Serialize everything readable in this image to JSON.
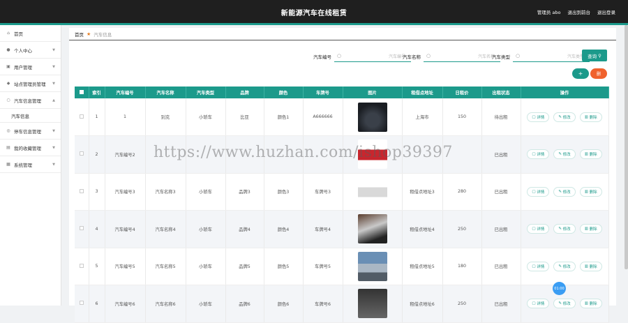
{
  "header": {
    "title": "新能源汽车在线租赁",
    "admin_label": "管理员 abo",
    "back_label": "退出到前台",
    "logout_label": "退出登录"
  },
  "sidebar": {
    "items": [
      {
        "label": "首页",
        "icon": "home-icon"
      },
      {
        "label": "个人中心",
        "icon": "user-icon"
      },
      {
        "label": "用户管理",
        "icon": "users-icon"
      },
      {
        "label": "站点管理员管理",
        "icon": "pin-icon"
      },
      {
        "label": "汽车信息管理",
        "icon": "car-icon"
      },
      {
        "label": "汽车信息",
        "sub": true
      },
      {
        "label": "停车信息管理",
        "icon": "parking-icon"
      },
      {
        "label": "我的收藏管理",
        "icon": "star-icon"
      },
      {
        "label": "系统管理",
        "icon": "settings-icon"
      }
    ]
  },
  "breadcrumb": {
    "home": "首页",
    "current": "汽车信息"
  },
  "search": {
    "fields": [
      {
        "label": "汽车编号",
        "placeholder": "汽车编号"
      },
      {
        "label": "汽车名称",
        "placeholder": "汽车名称"
      },
      {
        "label": "汽车类型",
        "placeholder": "汽车类型"
      }
    ],
    "button": "查询"
  },
  "actions": {
    "add": "+",
    "delete": "删"
  },
  "table": {
    "headers": [
      "",
      "索引",
      "汽车编号",
      "汽车名称",
      "汽车类型",
      "品牌",
      "颜色",
      "车牌号",
      "图片",
      "租借点地址",
      "日租价",
      "出租状态",
      "操作"
    ],
    "rows": [
      {
        "index": "1",
        "code": "1",
        "name": "别克",
        "type": "小轿车",
        "brand": "比亚",
        "color": "颜色1",
        "plate": "A666666",
        "img": "car1",
        "addr": "上海市",
        "price": "150",
        "status": "待出租"
      },
      {
        "index": "2",
        "code": "汽车编号2",
        "name": "",
        "type": "",
        "brand": "",
        "color": "",
        "plate": "",
        "img": "car2",
        "addr": "",
        "price": "",
        "status": "已出租"
      },
      {
        "index": "3",
        "code": "汽车编号3",
        "name": "汽车名称3",
        "type": "小轿车",
        "brand": "品牌3",
        "color": "颜色3",
        "plate": "车牌号3",
        "img": "car3",
        "addr": "租借点地址3",
        "price": "280",
        "status": "已出租"
      },
      {
        "index": "4",
        "code": "汽车编号4",
        "name": "汽车名称4",
        "type": "小轿车",
        "brand": "品牌4",
        "color": "颜色4",
        "plate": "车牌号4",
        "img": "car4",
        "addr": "租借点地址4",
        "price": "250",
        "status": "已出租"
      },
      {
        "index": "5",
        "code": "汽车编号5",
        "name": "汽车名称5",
        "type": "小轿车",
        "brand": "品牌5",
        "color": "颜色5",
        "plate": "车牌号5",
        "img": "car5",
        "addr": "租借点地址5",
        "price": "180",
        "status": "已出租"
      },
      {
        "index": "6",
        "code": "汽车编号6",
        "name": "汽车名称6",
        "type": "小轿车",
        "brand": "品牌6",
        "color": "颜色6",
        "plate": "车牌号6",
        "img": "car6",
        "addr": "租借点地址6",
        "price": "250",
        "status": "已出租"
      }
    ],
    "ops": {
      "detail": "详情",
      "edit": "修改",
      "remove": "删除"
    }
  },
  "watermark": "https://www.huzhan.com/ishop39397",
  "float_button": "01:00",
  "colors": {
    "accent": "#1c9a8b",
    "danger": "#f0622d",
    "topbar": "#1f1f1f"
  }
}
